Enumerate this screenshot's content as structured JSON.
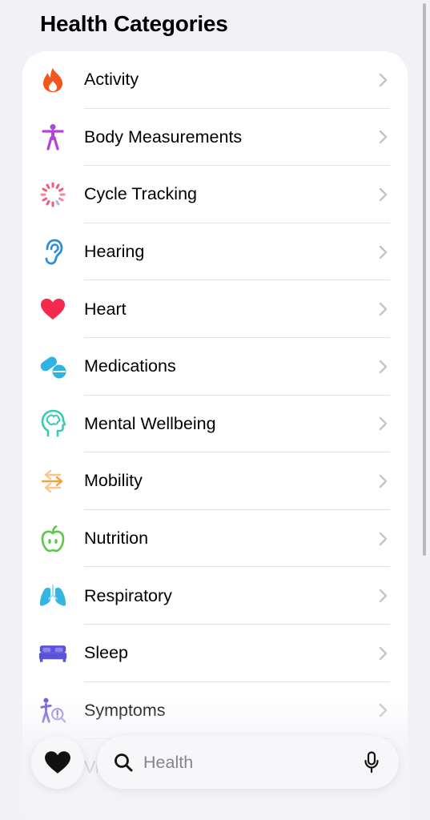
{
  "section": {
    "title": "Health Categories"
  },
  "categories": [
    {
      "label": "Activity",
      "icon": "flame-icon",
      "color": "#f5561b"
    },
    {
      "label": "Body Measurements",
      "icon": "figure-icon",
      "color": "#b146d6"
    },
    {
      "label": "Cycle Tracking",
      "icon": "cycle-dots-icon",
      "color": "#f15a7a"
    },
    {
      "label": "Hearing",
      "icon": "ear-icon",
      "color": "#2a8ed8"
    },
    {
      "label": "Heart",
      "icon": "heart-icon",
      "color": "#f5294e"
    },
    {
      "label": "Medications",
      "icon": "pills-icon",
      "color": "#2fb3e2"
    },
    {
      "label": "Mental Wellbeing",
      "icon": "brain-head-icon",
      "color": "#3bc9b6"
    },
    {
      "label": "Mobility",
      "icon": "arrows-icon",
      "color": "#f0a23a"
    },
    {
      "label": "Nutrition",
      "icon": "apple-icon",
      "color": "#5cc84a"
    },
    {
      "label": "Respiratory",
      "icon": "lungs-icon",
      "color": "#34b6e0"
    },
    {
      "label": "Sleep",
      "icon": "bed-icon",
      "color": "#5a52d8"
    },
    {
      "label": "Symptoms",
      "icon": "figure-alert-icon",
      "color": "#6b5bd0"
    },
    {
      "label": "Vitals",
      "icon": "vitals-icon",
      "color": "#f5294e"
    }
  ],
  "bottom_bar": {
    "search_placeholder": "Health",
    "favorites_icon": "heart-icon",
    "search_icon": "search-icon",
    "mic_icon": "mic-icon"
  }
}
